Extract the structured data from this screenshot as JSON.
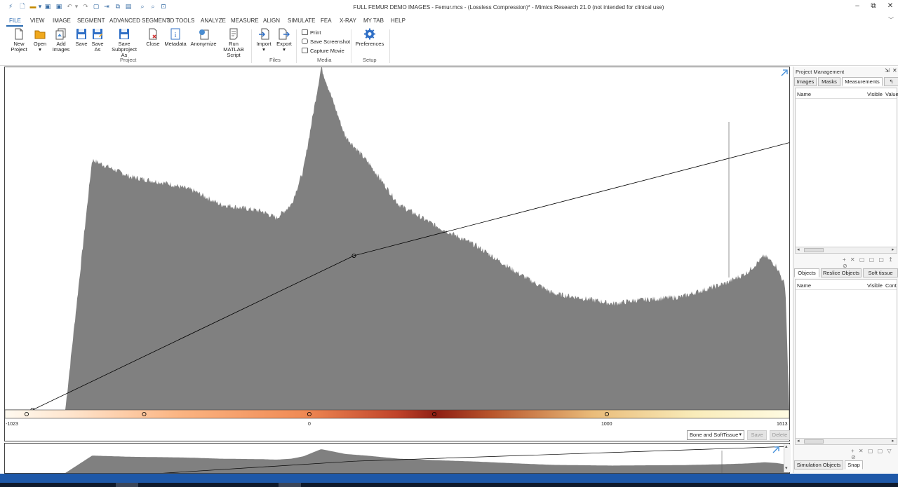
{
  "window": {
    "title": "FULL FEMUR DEMO IMAGES - Femur.mcs -  (Lossless Compression)* - Mimics Research 21.0 (not intended for clinical use)",
    "minimize_glyph": "–",
    "restore_glyph": "⧉",
    "close_glyph": "✕",
    "ribbon_toggle_glyph": "﹀"
  },
  "quick_access": [
    "mimics-logo-icon",
    "new-icon",
    "open-icon",
    "save-icon",
    "save-as-icon",
    "undo-icon",
    "redo-icon",
    "project-icon",
    "export-icon",
    "copy-icon",
    "paste-icon",
    "zoom-icon",
    "zoom-out-icon",
    "fit-icon"
  ],
  "menu": {
    "items": [
      "FILE",
      "VIEW",
      "IMAGE",
      "SEGMENT",
      "ADVANCED SEGMENT",
      "3D TOOLS",
      "ANALYZE",
      "MEASURE",
      "ALIGN",
      "SIMULATE",
      "FEA",
      "X-RAY",
      "MY TAB",
      "HELP"
    ],
    "active": "FILE"
  },
  "ribbon": {
    "project": {
      "label": "Project",
      "buttons": [
        {
          "line1": "New",
          "line2": "Project",
          "icon": "new-project-icon"
        },
        {
          "line1": "Open",
          "line2": "▾",
          "icon": "open-folder-icon"
        },
        {
          "line1": "Add",
          "line2": "Images",
          "icon": "add-images-icon"
        },
        {
          "line1": "Save",
          "line2": "",
          "icon": "save-icon"
        },
        {
          "line1": "Save",
          "line2": "As",
          "icon": "save-as-icon"
        },
        {
          "line1": "Save Subproject",
          "line2": "As",
          "icon": "save-subproject-icon"
        },
        {
          "line1": "Close",
          "line2": "",
          "icon": "close-project-icon"
        },
        {
          "line1": "Metadata",
          "line2": "",
          "icon": "metadata-icon"
        },
        {
          "line1": "Anonymize",
          "line2": "",
          "icon": "anonymize-icon"
        },
        {
          "line1": "Run MATLAB",
          "line2": "Script",
          "icon": "matlab-script-icon"
        }
      ]
    },
    "files": {
      "label": "Files",
      "buttons": [
        {
          "line1": "Import",
          "line2": "▾",
          "icon": "import-icon"
        },
        {
          "line1": "Export",
          "line2": "▾",
          "icon": "export-icon"
        }
      ]
    },
    "media": {
      "label": "Media",
      "buttons": [
        "Print",
        "Save Screenshot",
        "Capture Movie"
      ]
    },
    "setup": {
      "label": "Setup",
      "buttons": [
        {
          "line1": "Preferences",
          "icon": "gear-icon"
        }
      ]
    }
  },
  "histogram": {
    "axis_labels": [
      "-1023",
      "0",
      "1000",
      "1613"
    ],
    "preset": "Bone and SoftTissue",
    "save_label": "Save",
    "delete_label": "Delete",
    "colors": {
      "bars": "#808080",
      "line": "#000000",
      "border": "#444444"
    }
  },
  "chart_data": {
    "type": "area",
    "x": [
      -1023,
      -820,
      -730,
      -600,
      -470,
      -390,
      -300,
      -160,
      -110,
      -60,
      -20,
      40,
      120,
      200,
      300,
      420,
      560,
      700,
      820,
      960,
      1020,
      1100,
      1250,
      1400,
      1470,
      1530,
      1570,
      1600,
      1613
    ],
    "values": [
      0,
      0,
      73,
      68,
      66,
      64,
      60,
      58,
      56,
      60,
      70,
      100,
      80,
      72,
      60,
      54,
      48,
      40,
      34,
      32,
      31,
      32,
      33,
      37,
      40,
      45,
      42,
      36,
      0
    ],
    "xlim": [
      -1023,
      1613
    ],
    "ylim": [
      0,
      100
    ],
    "transfer_points": [
      [
        -1023,
        0
      ],
      [
        -930,
        0
      ],
      [
        150,
        45
      ],
      [
        1613,
        78
      ]
    ],
    "colormap_handles": [
      -950,
      -555,
      0,
      420,
      1000
    ],
    "grid": false
  },
  "project_management": {
    "title": "Project Management",
    "pin_glyph": "⇲",
    "close_glyph": "✕",
    "top_tabs": [
      "Images",
      "Masks",
      "Measurements",
      "↰"
    ],
    "top_active": "Measurements",
    "top_columns": [
      "Name",
      "Visible",
      "Value"
    ],
    "top_tools": "+ ✕ ▢ ▢ ▢ ↥ ⊘",
    "mid_tabs": [
      "Objects",
      "Reslice Objects",
      "Soft tissue"
    ],
    "mid_active": "Objects",
    "mid_columns": [
      "Name",
      "Visible",
      "Cont"
    ],
    "mid_tools": "+ ✕ ▢ ▢ ▽ ⊘",
    "bottom_tabs": [
      "Simulation Objects",
      "Snap"
    ],
    "bottom_active": "Snap"
  }
}
